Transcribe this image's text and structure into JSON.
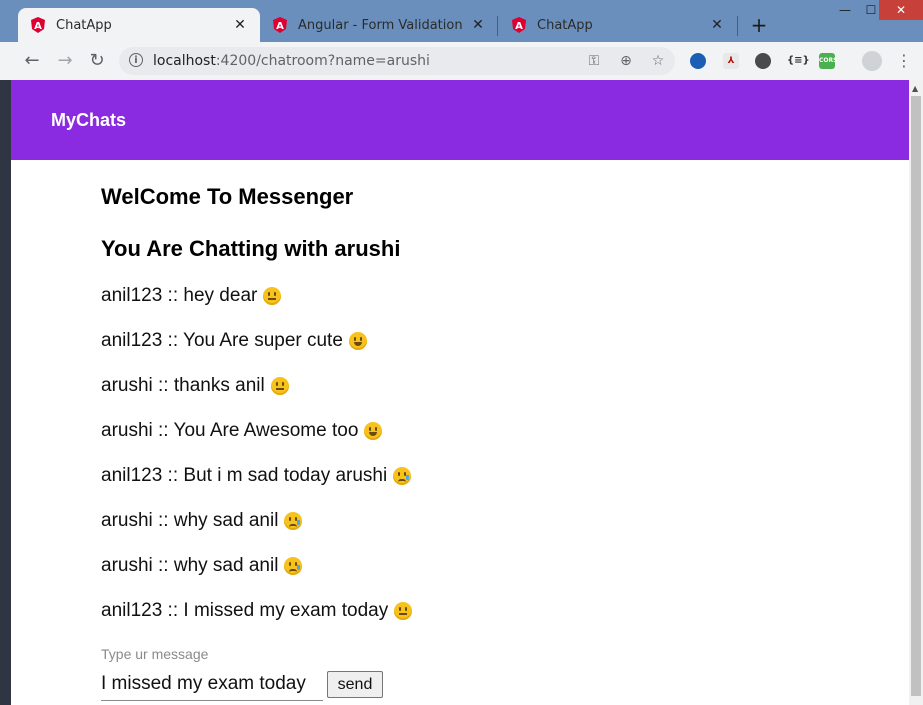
{
  "browser": {
    "tabs": [
      {
        "label": "ChatApp",
        "active": true
      },
      {
        "label": "Angular - Form Validation",
        "active": false
      },
      {
        "label": "ChatApp",
        "active": false
      }
    ],
    "url_host": "localhost",
    "url_rest": ":4200/chatroom?name=arushi",
    "extensions": [
      "CORS"
    ],
    "menu_glyph": "⋮"
  },
  "app": {
    "brand": "MyChats",
    "welcome": "WelCome To Messenger",
    "chatting_with": "You Are Chatting with arushi",
    "messages": [
      {
        "text": "anil123 :: hey dear",
        "emoji": "neutral"
      },
      {
        "text": "anil123 :: You Are super cute",
        "emoji": "grin"
      },
      {
        "text": "arushi :: thanks anil",
        "emoji": "neutral"
      },
      {
        "text": "arushi :: You Are Awesome too",
        "emoji": "grin"
      },
      {
        "text": "anil123 :: But i m sad today arushi",
        "emoji": "sad"
      },
      {
        "text": "arushi :: why sad anil",
        "emoji": "sad"
      },
      {
        "text": "arushi :: why sad anil",
        "emoji": "sad"
      },
      {
        "text": "anil123 :: I missed my exam today",
        "emoji": "neutral"
      }
    ],
    "input_label": "Type ur message",
    "input_value": "I missed my exam today",
    "send_label": "send"
  },
  "colors": {
    "appbar": "#8a2be2",
    "frame": "#6a8fbc"
  }
}
